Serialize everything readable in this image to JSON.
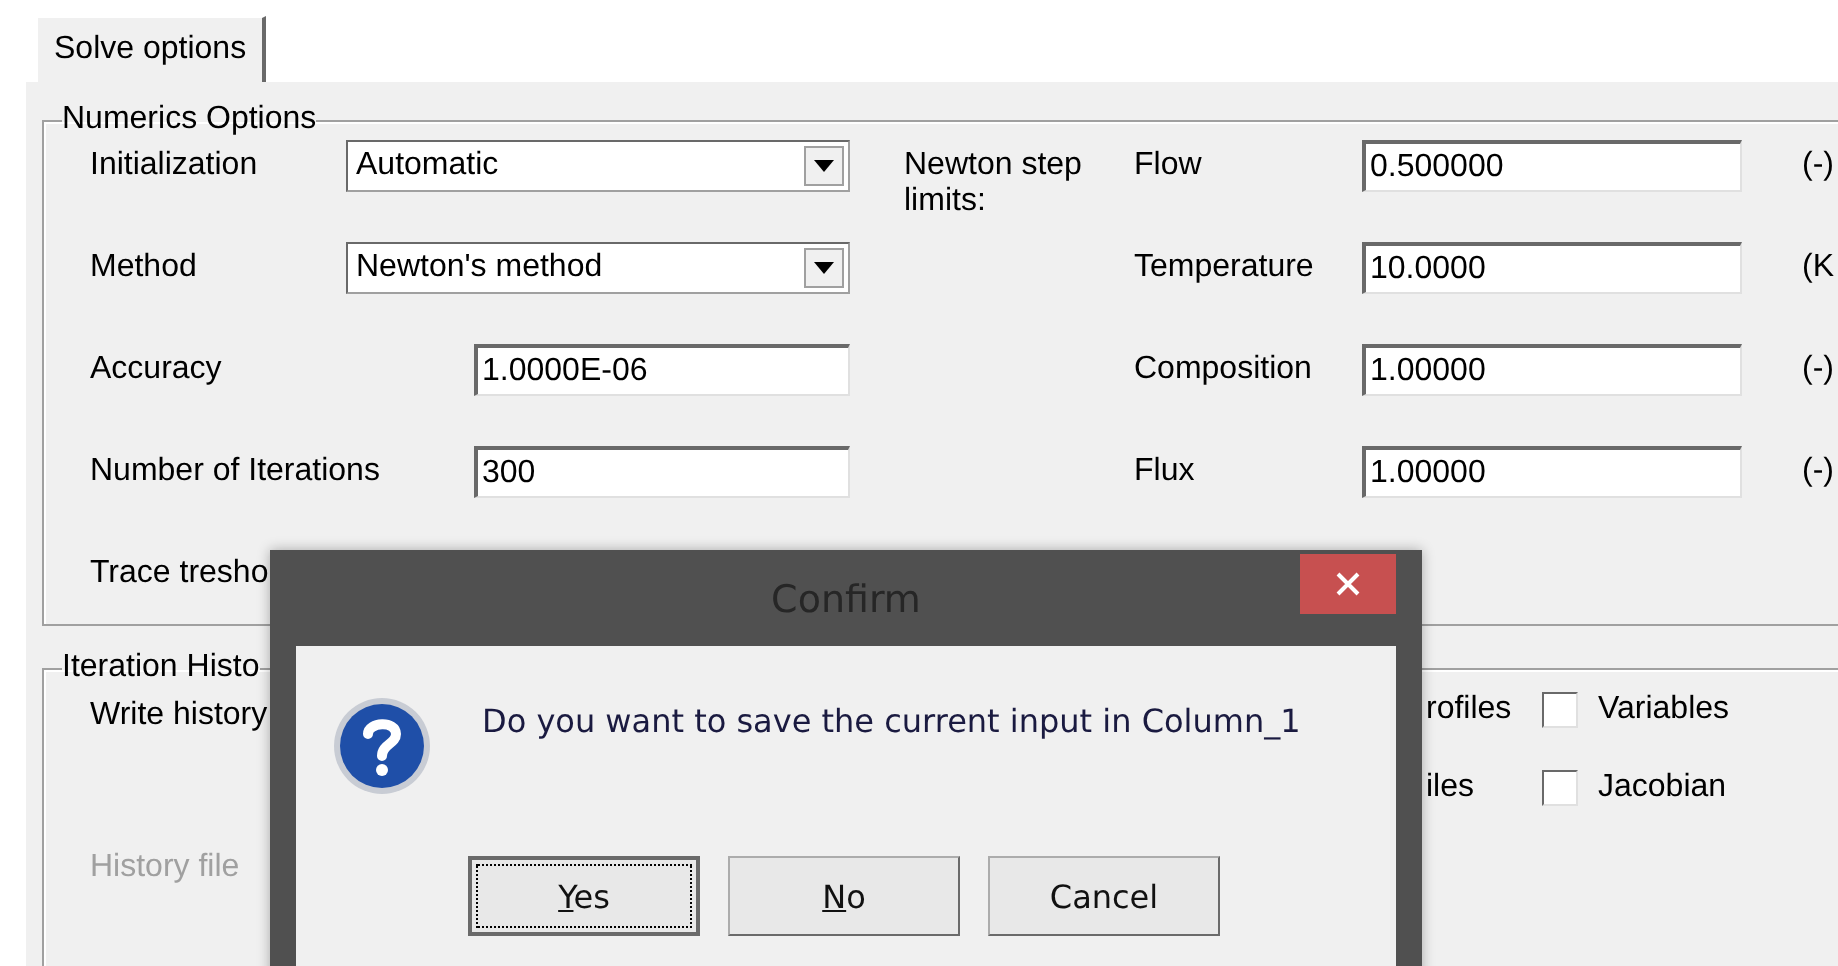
{
  "tabs": [
    {
      "label": "Solve options",
      "selected": true
    }
  ],
  "numerics_options": {
    "title": "Numerics Options",
    "fields": [
      {
        "kind": "combo",
        "label": "Initialization",
        "value": "Automatic"
      },
      {
        "kind": "combo",
        "label": "Method",
        "value": "Newton's method"
      },
      {
        "kind": "text",
        "label": "Accuracy",
        "value": "1.0000E-06"
      },
      {
        "kind": "text",
        "label": "Number of Iterations",
        "value": "300"
      },
      {
        "kind": "label",
        "label": "Trace tresho"
      }
    ],
    "step_limits": {
      "title": "Newton step limits:",
      "fields": [
        {
          "label": "Flow",
          "value": "0.500000",
          "unit": "(-)"
        },
        {
          "label": "Temperature",
          "value": "10.0000",
          "unit": "(K"
        },
        {
          "label": "Composition",
          "value": "1.00000",
          "unit": "(-)"
        },
        {
          "label": "Flux",
          "value": "1.00000",
          "unit": "(-)"
        }
      ]
    }
  },
  "iteration_history": {
    "title": "Iteration Histo",
    "write_history": "Write history",
    "history_file": {
      "label": "History file",
      "disabled": true
    },
    "options": [
      {
        "label": "rofiles",
        "checkbox": "Variables",
        "checked": false
      },
      {
        "label": "iles",
        "checkbox": "Jacobian",
        "checked": false
      }
    ]
  },
  "dialog": {
    "title": "Confirm",
    "message": "Do you want to save the current input in Column_1",
    "buttons": [
      {
        "label": "Yes",
        "focused": true,
        "underline_first": true
      },
      {
        "label": "No",
        "focused": false,
        "underline_first": true
      },
      {
        "label": "Cancel",
        "focused": false,
        "underline_first": false
      }
    ]
  }
}
